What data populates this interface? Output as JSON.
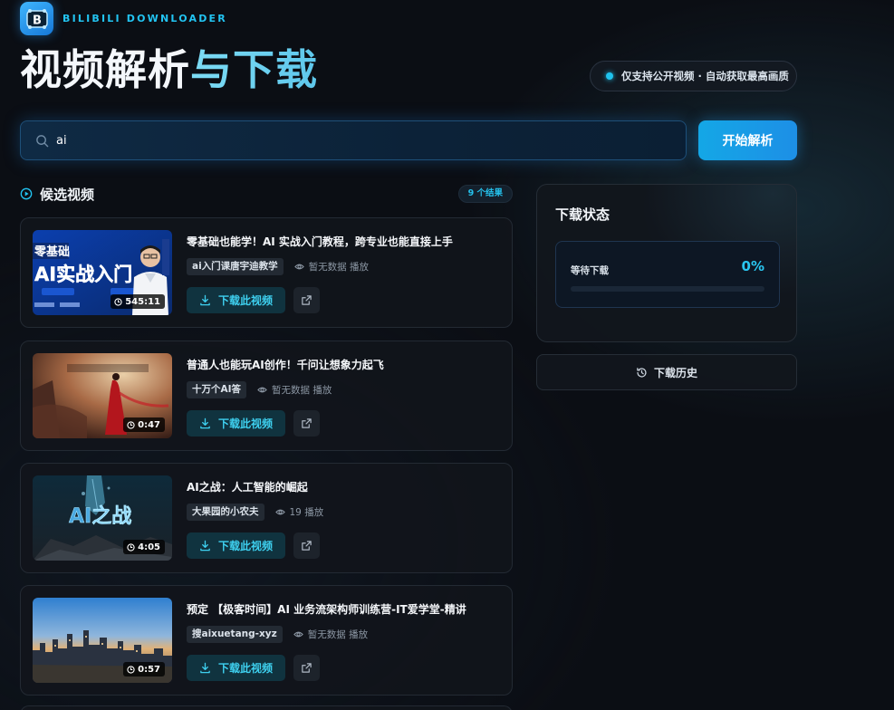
{
  "brand": {
    "name": "BILIBILI DOWNLOADER",
    "logo_letter": "B"
  },
  "header": {
    "title_part1": "视频解析",
    "title_part2": "与下载",
    "notice": "仅支持公开视频 · 自动获取最高画质"
  },
  "search": {
    "value": "ai",
    "button_label": "开始解析"
  },
  "candidates": {
    "title": "候选视频",
    "count_badge": "9 个结果",
    "download_label": "下载此视频",
    "items": [
      {
        "title": "零基础也能学！AI 实战入门教程，跨专业也能直接上手",
        "uploader": "ai入门课唐宇迪教学",
        "plays": "暂无数据 播放",
        "duration": "545:11",
        "thumb_text": "AI实战入门"
      },
      {
        "title": "普通人也能玩AI创作！千问让想象力起飞",
        "uploader": "十万个AI答",
        "plays": "暂无数据 播放",
        "duration": "0:47",
        "thumb_text": ""
      },
      {
        "title": "AI之战：人工智能的崛起",
        "uploader": "大果园的小农夫",
        "plays": "19 播放",
        "duration": "4:05",
        "thumb_text": "AI之战"
      },
      {
        "title": "预定 【极客时间】AI 业务流架构师训练营-IT爱学堂-精讲",
        "uploader": "搜aixuetang-xyz",
        "plays": "暂无数据 播放",
        "duration": "0:57",
        "thumb_text": ""
      }
    ]
  },
  "status": {
    "title": "下载状态",
    "label": "等待下载",
    "percent_text": "0%",
    "progress_value": 0
  },
  "history": {
    "label": "下载历史"
  },
  "colors": {
    "accent": "#22c4f2",
    "background": "#0b0e14",
    "card": "#11151b"
  }
}
